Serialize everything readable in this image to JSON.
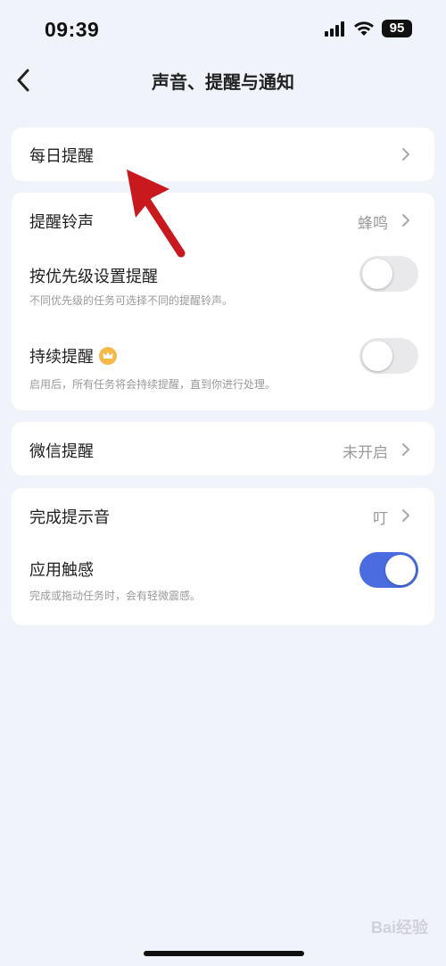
{
  "status_bar": {
    "time": "09:39",
    "battery": "95"
  },
  "nav": {
    "title": "声音、提醒与通知"
  },
  "daily_reminder": {
    "label": "每日提醒"
  },
  "ringtone": {
    "label": "提醒铃声",
    "value": "蜂鸣"
  },
  "priority": {
    "label": "按优先级设置提醒",
    "desc": "不同优先级的任务可选择不同的提醒铃声。",
    "enabled": false
  },
  "continuous": {
    "label": "持续提醒",
    "desc": "启用后，所有任务将会持续提醒，直到你进行处理。",
    "enabled": false,
    "badge_icon": "crown-icon"
  },
  "wechat": {
    "label": "微信提醒",
    "value": "未开启"
  },
  "complete_sound": {
    "label": "完成提示音",
    "value": "叮"
  },
  "haptics": {
    "label": "应用触感",
    "desc": "完成或拖动任务时，会有轻微震感。",
    "enabled": true
  },
  "colors": {
    "background": "#F1F3FB",
    "toggle_on": "#4A6CE0",
    "toggle_off": "#E9E9EB",
    "annotation_arrow": "#C8191E",
    "crown": "#F5B94A"
  },
  "watermark": "Bai经验"
}
